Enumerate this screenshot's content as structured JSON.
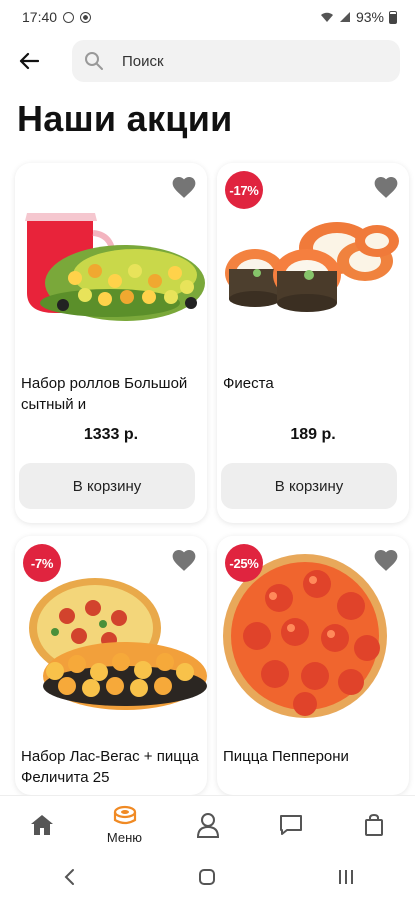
{
  "status_bar": {
    "time": "17:40",
    "battery": "93%"
  },
  "search": {
    "placeholder": "Поиск"
  },
  "page_title": "Наши акции",
  "colors": {
    "accent": "#e0243f",
    "menu_active": "#f08a24",
    "button_bg": "#eeeeee"
  },
  "products": [
    {
      "name": "Набор роллов Большой сытный и",
      "price": "1333 р.",
      "badge": "",
      "button": "В корзину",
      "image": "roll-set-with-juice-pitcher"
    },
    {
      "name": "Фиеста",
      "price": "189 р.",
      "badge": "-17%",
      "button": "В корзину",
      "image": "salmon-rolls"
    },
    {
      "name": "Набор Лас-Вегас + пицца Феличита 25",
      "price": "",
      "badge": "-7%",
      "button": "",
      "image": "pizza-with-rolls"
    },
    {
      "name": "Пицца Пепперони",
      "price": "",
      "badge": "-25%",
      "button": "",
      "image": "pepperoni-pizza"
    }
  ],
  "bottom_nav": [
    {
      "label": "",
      "icon": "home-icon"
    },
    {
      "label": "Меню",
      "icon": "menu-sushi-icon",
      "active": true
    },
    {
      "label": "",
      "icon": "profile-icon"
    },
    {
      "label": "",
      "icon": "chat-icon"
    },
    {
      "label": "",
      "icon": "bag-icon"
    }
  ]
}
